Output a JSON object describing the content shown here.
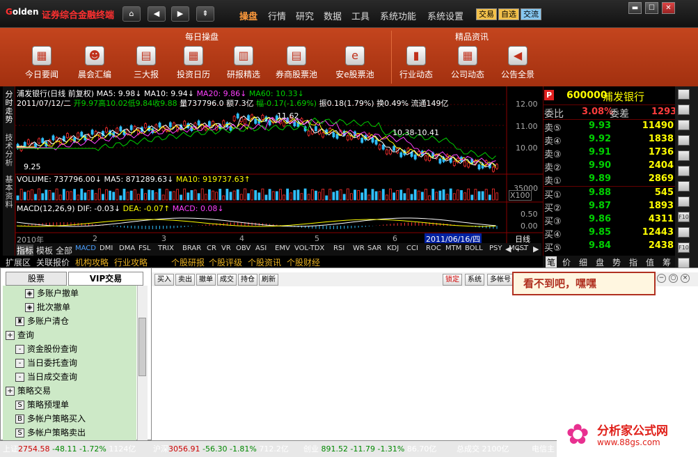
{
  "app": {
    "logo_prefix": "G",
    "logo_rest": "olden",
    "title": "证券综合金融终端"
  },
  "nav": {
    "home": "⌂",
    "back": "◀",
    "forward": "▶",
    "up": "⇞"
  },
  "menu": [
    "操盘",
    "行情",
    "研究",
    "数据",
    "工具",
    "系统功能",
    "系统设置"
  ],
  "mode_pills": [
    "交易",
    "自选",
    "交流"
  ],
  "window_buttons": [
    "▬",
    "☐",
    "✕"
  ],
  "ribbon": {
    "sections": [
      "每日操盘",
      "精品资讯"
    ],
    "items": [
      {
        "label": "今日要闻",
        "icon": "calendar-icon",
        "glyph": "▦"
      },
      {
        "label": "晨会汇编",
        "icon": "person-icon",
        "glyph": "☻"
      },
      {
        "label": "三大报",
        "icon": "newspaper-icon",
        "glyph": "▤"
      },
      {
        "label": "投资日历",
        "icon": "calendar-icon",
        "glyph": "▦"
      },
      {
        "label": "研报精选",
        "icon": "clipboard-icon",
        "glyph": "▥"
      },
      {
        "label": "券商股票池",
        "icon": "printer-icon",
        "glyph": "▤"
      },
      {
        "label": "安e股票池",
        "icon": "board-icon",
        "glyph": "e"
      },
      {
        "label": "行业动态",
        "icon": "bar-chart-icon",
        "glyph": "▮"
      },
      {
        "label": "公司动态",
        "icon": "building-icon",
        "glyph": "▦"
      },
      {
        "label": "公告全景",
        "icon": "megaphone-icon",
        "glyph": "◀"
      }
    ]
  },
  "chart": {
    "header": "浦发银行(日线 前复权) MA5: 9.98↓  MA10: 9.94↓",
    "ma20": "MA20: 9.86↓",
    "ma60": "MA60: 10.33↓",
    "info_date": "2011/07/12/二",
    "info_open": "开9.97",
    "info_high": "高10.02",
    "info_low": "低9.84",
    "info_close": "收9.88",
    "info_vol": "量737796.0",
    "info_amt": "额7.3亿",
    "info_chg": "幅-0.17(-1.69%)",
    "info_rest": "振0.18(1.79%) 换0.49% 流通149亿",
    "price_labels": [
      "12.00",
      "11.00",
      "10.00"
    ],
    "peak": "11.62",
    "mid_range": "10.38-10.41",
    "low": "9.25",
    "vol_tick": "35000",
    "vol_unit": "X100",
    "macd_ticks": [
      "0.50",
      "0.00"
    ],
    "volume_header": "VOLUME: 737796.00↓",
    "vol_ma5": "MA5: 871289.63↓",
    "vol_ma10": "MA10: 919737.63↑",
    "macd_header": "MACD(12,26,9)",
    "macd_dif": "DIF: -0.03↓",
    "macd_dea": "DEA: -0.07↑",
    "macd_val": "MACD: 0.08↓",
    "year": "2010年",
    "months": [
      "2",
      "3",
      "4",
      "5",
      "6"
    ],
    "cursor_date": "2011/06/16/四",
    "period": "日线",
    "side_tabs": [
      "分时走势",
      "技术分析",
      "基本资料"
    ]
  },
  "indicator_tabs": [
    "指标",
    "模板",
    "全部",
    "MACD",
    "DMI",
    "DMA",
    "FSL",
    "TRIX",
    "BRAR",
    "CR",
    "VR",
    "OBV",
    "ASI",
    "EMV",
    "VOL-TDX",
    "RSI",
    "WR",
    "SAR",
    "KDJ",
    "CCI",
    "ROC",
    "MTM",
    "BOLL",
    "PSY",
    "MCST"
  ],
  "chart_controls": [
    "◀",
    "+",
    "-",
    "▶"
  ],
  "link_tabs": [
    "扩展区",
    "关联报价",
    "机构攻略",
    "行业攻略",
    "个股研报",
    "个股评级",
    "个股资讯",
    "个股财经"
  ],
  "quote": {
    "badge": "P",
    "code": "600000",
    "name": "浦发银行",
    "ratio_label": "委比",
    "ratio": "3.08%",
    "diff_label": "委差",
    "diff": "1293",
    "asks": [
      {
        "label": "卖⑤",
        "price": "9.93",
        "vol": "11490"
      },
      {
        "label": "卖④",
        "price": "9.92",
        "vol": "1838"
      },
      {
        "label": "卖③",
        "price": "9.91",
        "vol": "1736"
      },
      {
        "label": "卖②",
        "price": "9.90",
        "vol": "2404"
      },
      {
        "label": "卖①",
        "price": "9.89",
        "vol": "2869"
      }
    ],
    "bids": [
      {
        "label": "买①",
        "price": "9.88",
        "vol": "545"
      },
      {
        "label": "买②",
        "price": "9.87",
        "vol": "1893"
      },
      {
        "label": "买③",
        "price": "9.86",
        "vol": "4311"
      },
      {
        "label": "买④",
        "price": "9.85",
        "vol": "12443"
      },
      {
        "label": "买⑤",
        "price": "9.84",
        "vol": "2438"
      }
    ],
    "tabs": [
      "笔",
      "价",
      "细",
      "盘",
      "势",
      "指",
      "值",
      "筹"
    ]
  },
  "right_tools": [
    "",
    "",
    "",
    "",
    "",
    "",
    "",
    "",
    "F10",
    "",
    "F10",
    "",
    "Fiz",
    ""
  ],
  "left_panel": {
    "tabs": [
      "股票",
      "VIP交易"
    ],
    "tree": [
      {
        "label": "多账户撤单",
        "level": 2,
        "icon": "◈"
      },
      {
        "label": "批次撤单",
        "level": 2,
        "icon": "◈"
      },
      {
        "label": "多账户清仓",
        "level": 1,
        "icon": "♜"
      },
      {
        "label": "查询",
        "level": 0,
        "icon": "+"
      },
      {
        "label": "资金股份查询",
        "level": 1,
        "icon": "-"
      },
      {
        "label": "当日委托查询",
        "level": 1,
        "icon": "-"
      },
      {
        "label": "当日成交查询",
        "level": 1,
        "icon": "-"
      },
      {
        "label": "策略交易",
        "level": 0,
        "icon": "+"
      },
      {
        "label": "策略预埋单",
        "level": 1,
        "icon": "S"
      },
      {
        "label": "多帐户策略买入",
        "level": 1,
        "icon": "B"
      },
      {
        "label": "多帐户策略卖出",
        "level": 1,
        "icon": "S"
      }
    ]
  },
  "trade_toolbar": {
    "left": [
      "买入",
      "卖出",
      "撤单",
      "成交",
      "持仓",
      "刷新"
    ],
    "right": [
      "锁定",
      "系统",
      "多帐号"
    ]
  },
  "popup": "看不到吧，嘿嘿",
  "status": {
    "sh_label": "上证",
    "sh_val": "2754.58",
    "sh_chg": "-48.11",
    "sh_pct": "-1.72%",
    "sh_amt": "1124亿",
    "sz_label": "沪深",
    "sz_val": "3056.91",
    "sz_chg": "-56.30",
    "sz_pct": "-1.81%",
    "sz_amt": "712.2亿",
    "cy_label": "创业",
    "cy_val": "891.52",
    "cy_chg": "-11.79",
    "cy_pct": "-1.31%",
    "cy_amt": "86.70亿",
    "total_label": "总成交",
    "total_val": "2100亿",
    "telecom": "电信主"
  },
  "watermark": {
    "name": "分析家公式网",
    "url": "www.88gs.com"
  }
}
